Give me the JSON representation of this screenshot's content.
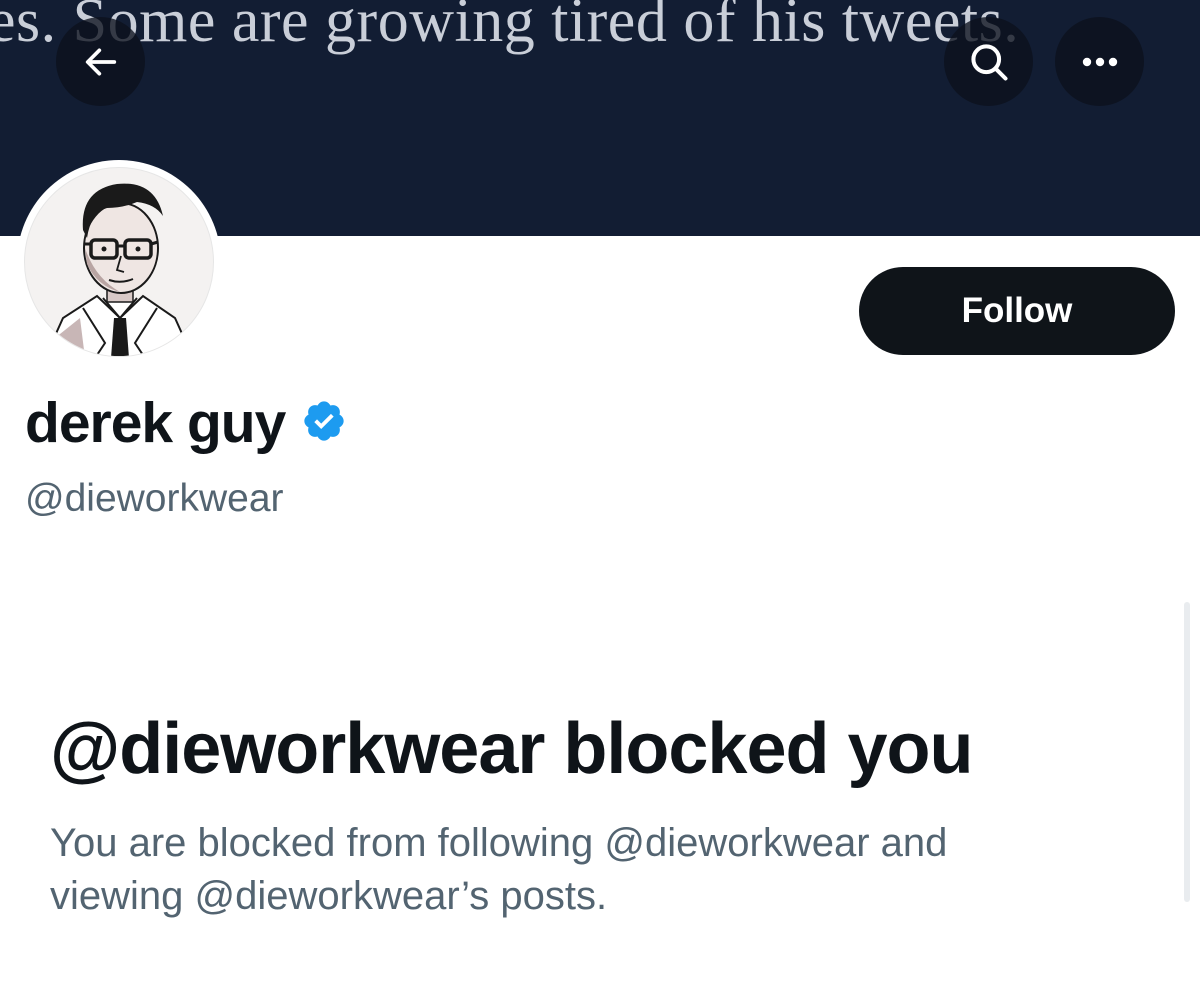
{
  "banner": {
    "text": "es. Some are growing tired of his tweets.",
    "background_color": "#121d33"
  },
  "header": {
    "back_icon": "arrow-left-icon",
    "search_icon": "search-icon",
    "more_icon": "more-horizontal-icon"
  },
  "profile": {
    "display_name": "derek guy",
    "verified_icon": "verified-badge-icon",
    "verified_color": "#1d9bf0",
    "handle": "@dieworkwear",
    "follow_label": "Follow"
  },
  "blocked": {
    "heading": "@dieworkwear blocked you",
    "description_line1": "You are blocked from following @dieworkwear and",
    "description_line2": "viewing @dieworkwear’s posts."
  },
  "colors": {
    "primary_text": "#0f1419",
    "secondary_text": "#536471",
    "button_background": "#0f1419"
  }
}
